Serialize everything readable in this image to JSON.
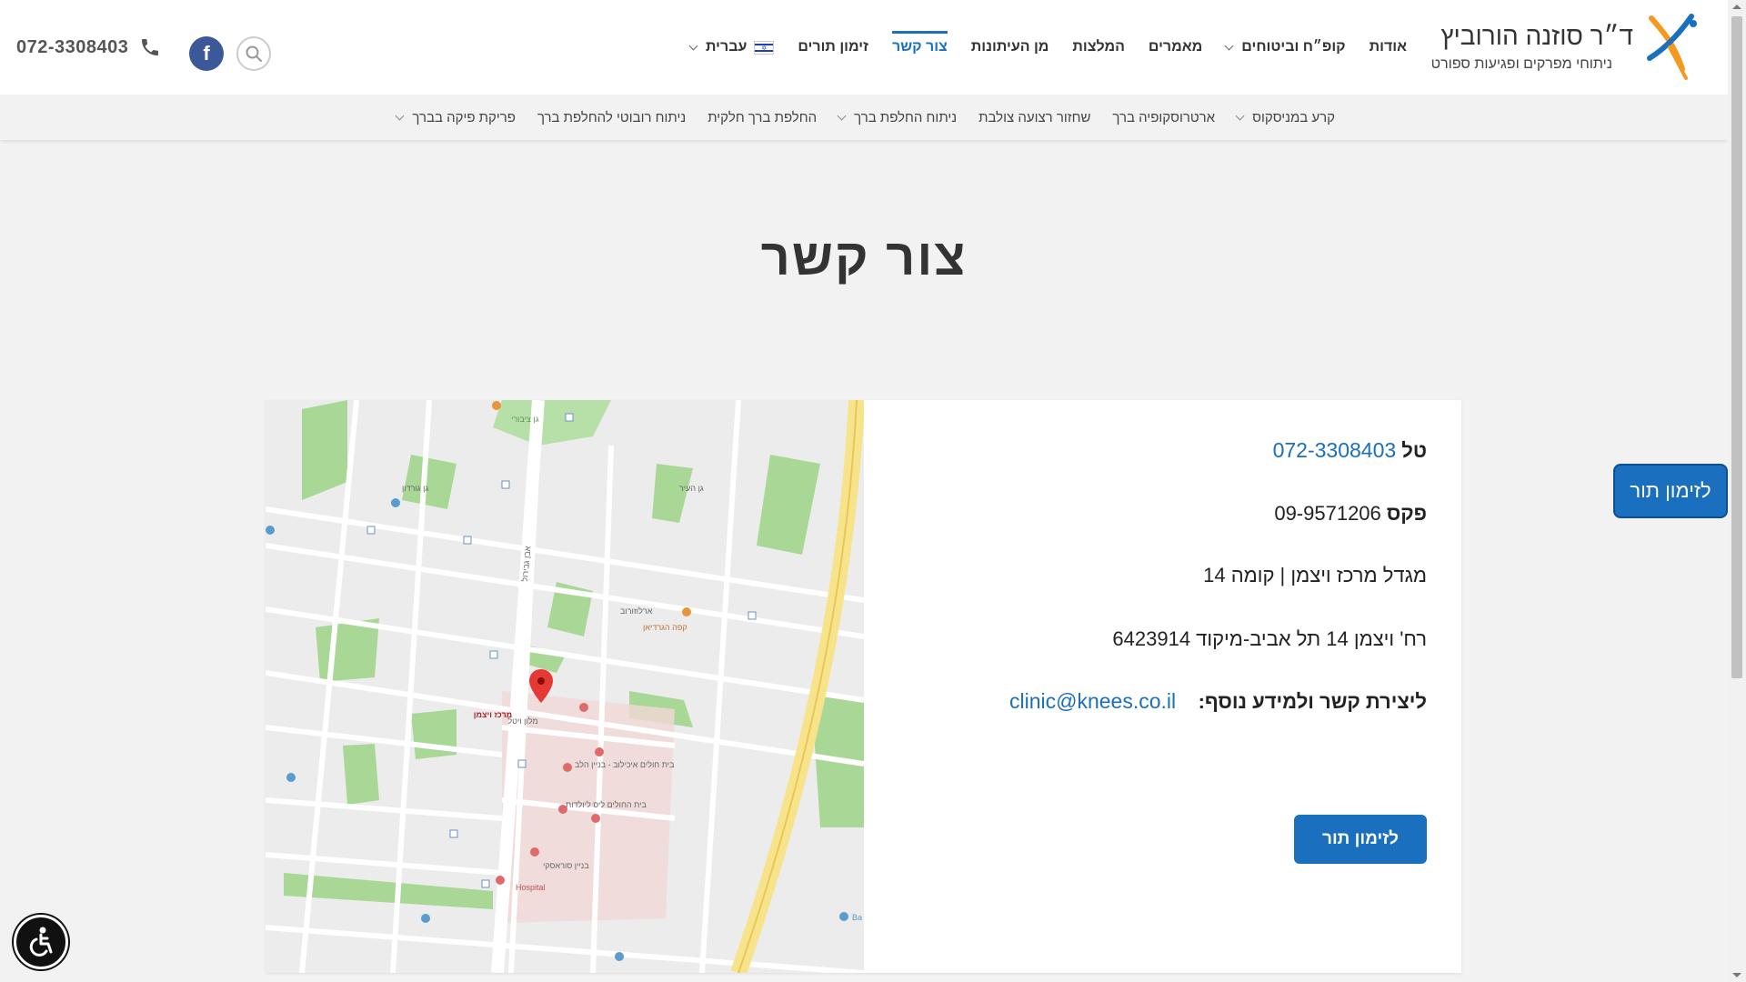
{
  "header": {
    "logo_title": "ד״ר סוזנה הורוביץ",
    "logo_subtitle": "ניתוחי מפרקים ופגיעות ספורט",
    "phone": "072-3308403",
    "facebook_label": "f",
    "colors": {
      "accent": "#1a6fbf",
      "logo_orange": "#f39a1e",
      "logo_blue": "#1a6fbf"
    }
  },
  "main_nav": {
    "items": [
      {
        "label": "אודות"
      },
      {
        "label": "קופ״ח וביטוחים"
      },
      {
        "label": "מאמרים"
      },
      {
        "label": "המלצות"
      },
      {
        "label": "מן העיתונות"
      },
      {
        "label": "צור קשר"
      },
      {
        "label": "זימון תורים"
      },
      {
        "label": "עברית"
      }
    ]
  },
  "sub_nav": {
    "items": [
      {
        "label": "קרע במניסקוס"
      },
      {
        "label": "ארטרוסקופיה ברך"
      },
      {
        "label": "שחזור רצועה צולבת"
      },
      {
        "label": "ניתוח החלפת ברך"
      },
      {
        "label": "החלפת ברך חלקית"
      },
      {
        "label": "ניתוח רובוטי להחלפת ברך"
      },
      {
        "label": "פריקת פיקה בברך"
      }
    ]
  },
  "page": {
    "title": "צור קשר"
  },
  "contact": {
    "phone_label": "טל",
    "phone_value": "072-3308403",
    "fax_label": "פקס",
    "fax_value": "09-9571206",
    "building": "מגדל מרכז ויצמן | קומה 14",
    "address": "רח' ויצמן 14 תל אביב-מיקוד 6423914",
    "email_label": "ליצירת קשר ולמידע נוסף:",
    "email_value": "clinic@knees.co.il",
    "book_button": "לזימון תור"
  },
  "side_button": "לזימון תור",
  "map": {
    "labels": {
      "weizmann_center": "מרכז ויצמן",
      "hotel": "מלון ויטל",
      "hospital": "Hospital",
      "internal": "בית חולים איכילוב - בניין הלב",
      "maternity": "בית החולים ליס ליולדות",
      "cardio": "בניין סוראסקי",
      "arlozorov": "ארלוזורוב",
      "ibn_gvirol": "אבן גבירול",
      "park1": "גן גורדון",
      "park2": "גן העיר",
      "cafe": "קפה הגרדיאן",
      "hilton": "Ba",
      "top_label": "גן ציבורי"
    }
  }
}
